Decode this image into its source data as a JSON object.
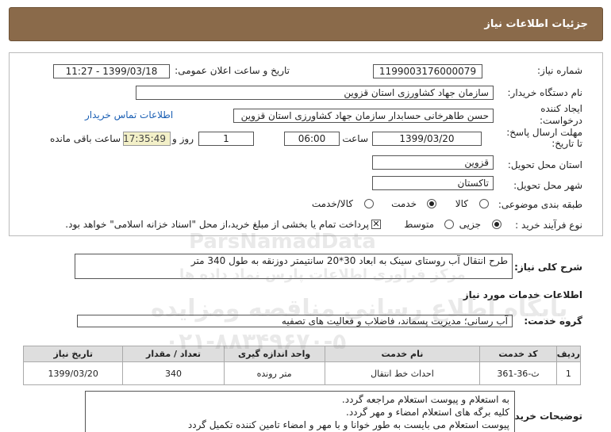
{
  "header": {
    "title": "جزئیات اطلاعات نیاز"
  },
  "form": {
    "need_number_label": "شماره نیاز:",
    "need_number": "1199003176000079",
    "announce_label": "تاریخ و ساعت اعلان عمومی:",
    "announce_value": "1399/03/18 - 11:27",
    "buyer_org_label": "نام دستگاه خریدار:",
    "buyer_org": "سازمان جهاد کشاورزی استان قزوین",
    "creator_label_1": "ایجاد کننده",
    "creator_label_2": "درخواست:",
    "creator": "حسن طاهرخانی حسابدار سازمان جهاد کشاورزی استان قزوین",
    "contact_link": "اطلاعات تماس خریدار",
    "deadline_label_1": "مهلت ارسال پاسخ:",
    "deadline_label_2": "تا تاریخ:",
    "deadline_date": "1399/03/20",
    "time_label": "ساعت",
    "deadline_time": "06:00",
    "days_value": "1",
    "days_label": "روز و",
    "remaining_time": "17:35:49",
    "remaining_label": "ساعت باقی مانده",
    "province_label": "استان محل تحویل:",
    "province": "قزوین",
    "city_label": "شهر محل تحویل:",
    "city": "تاکستان",
    "category_label": "طبقه بندی موضوعی:",
    "category_options": [
      "کالا",
      "خدمت",
      "کالا/خدمت"
    ],
    "category_selected": "خدمت",
    "process_label": "نوع فرآیند خرید :",
    "process_options": [
      "جزیی",
      "متوسط"
    ],
    "process_selected": "جزیی",
    "payment_note": "پرداخت تمام یا بخشی از مبلغ خرید،از محل \"اسناد خزانه اسلامی\" خواهد بود.",
    "payment_checked": true
  },
  "summary": {
    "label": "شرح کلی نیاز:",
    "text": "طرح انتقال آب روستای سینک به ابعاد 30*20 سانتیمتر دوزنقه به طول 340 متر"
  },
  "services": {
    "section_title": "اطلاعات خدمات مورد نیاز",
    "group_label": "گروه خدمت:",
    "group_value": "آب رسانی؛ مدیریت پسماند، فاضلاب و فعالیت های تصفیه",
    "columns": [
      "ردیف",
      "کد خدمت",
      "نام خدمت",
      "واحد اندازه گیری",
      "تعداد / مقدار",
      "تاریخ نیاز"
    ],
    "rows": [
      {
        "row": "1",
        "code": "ث-36-361",
        "name": "احداث خط انتقال",
        "unit": "متر رونده",
        "qty": "340",
        "date": "1399/03/20"
      }
    ]
  },
  "buyer_notes": {
    "label": "توضیحات خریدار:",
    "lines": [
      "به استعلام و پیوست استعلام مراجعه گردد.",
      "کلیه برگه های استعلام امضاء و مهر گردد.",
      "پیوست استعلام می بایست به طور خوانا و با مهر و امضاء تامین کننده تکمیل گردد"
    ]
  },
  "watermark": {
    "brand": "ParsNamadData",
    "line1": "مرکز فراوری اطلاعات پارس نماد داده ها",
    "line2": "پایگاه اطلاع رسانی مناقصه ومزایده",
    "phone": "۰۲۱-۸۸۳۴۹۶۷۰-۵"
  }
}
